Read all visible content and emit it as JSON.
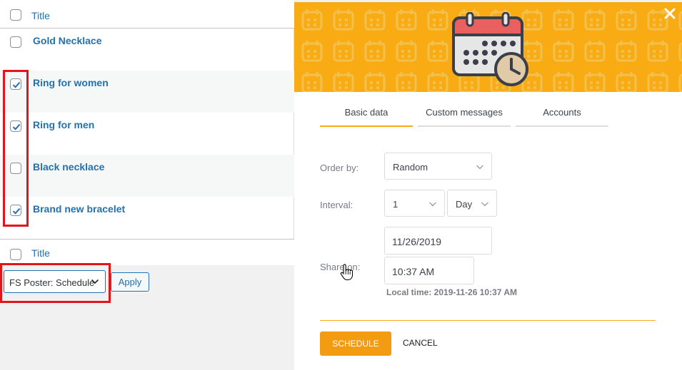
{
  "table": {
    "column_title": "Title",
    "rows": [
      {
        "title": "Gold Necklace",
        "checked": false
      },
      {
        "title": "Ring for women",
        "checked": true
      },
      {
        "title": "Ring for men",
        "checked": true
      },
      {
        "title": "Black necklace",
        "checked": false
      },
      {
        "title": "Brand new bracelet",
        "checked": true
      }
    ]
  },
  "bulk": {
    "action_selected": "FS Poster: Schedule",
    "apply_label": "Apply"
  },
  "modal": {
    "tabs": [
      {
        "label": "Basic data",
        "active": true
      },
      {
        "label": "Custom messages",
        "active": false
      },
      {
        "label": "Accounts",
        "active": false
      }
    ],
    "order_by": {
      "label": "Order by:",
      "value": "Random"
    },
    "interval": {
      "label": "Interval:",
      "value": "1",
      "unit": "Day"
    },
    "share_on": {
      "label": "Share on:",
      "date": "11/26/2019",
      "time": "10:37 AM"
    },
    "local_time": "Local time: 2019-11-26 10:37 AM",
    "schedule_label": "SCHEDULE",
    "cancel_label": "CANCEL"
  },
  "colors": {
    "accent": "#f8ab13",
    "link": "#2271b1",
    "highlight": "#e3141c",
    "calendar_red": "#e86060"
  },
  "icons": [
    "close-icon",
    "calendar-clock-icon",
    "chevron-down-icon",
    "checkmark-icon",
    "hand-cursor-icon"
  ]
}
